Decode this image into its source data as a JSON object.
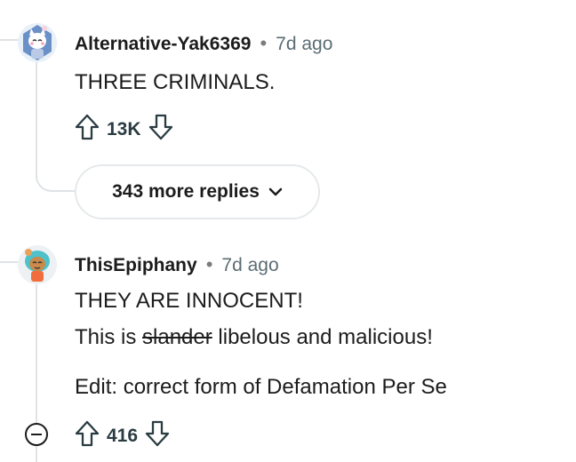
{
  "comments": [
    {
      "author": "Alternative-Yak6369",
      "separator": "•",
      "age": "7d ago",
      "lines": [
        "THREE CRIMINALS."
      ],
      "score": "13K",
      "avatar_icon": "snoo-cat-avatar-icon"
    },
    {
      "author": "ThisEpiphany",
      "separator": "•",
      "age": "7d ago",
      "line1": "THEY ARE INNOCENT!",
      "line2_prefix": "This is ",
      "line2_struck": "slander",
      "line2_suffix": " libelous and malicious!",
      "edit": "Edit: correct form of Defamation Per Se",
      "score": "416",
      "avatar_icon": "snoo-teal-hair-avatar-icon"
    }
  ],
  "more_replies": {
    "label": "343 more replies"
  },
  "icons": {
    "upvote": "upvote-arrow-icon",
    "downvote": "downvote-arrow-icon",
    "chevron": "chevron-down-icon",
    "collapse": "collapse-thread-icon"
  },
  "colors": {
    "thread_line": "#dfe3e6",
    "text": "#1c1c1c",
    "muted": "#5c6c74"
  }
}
